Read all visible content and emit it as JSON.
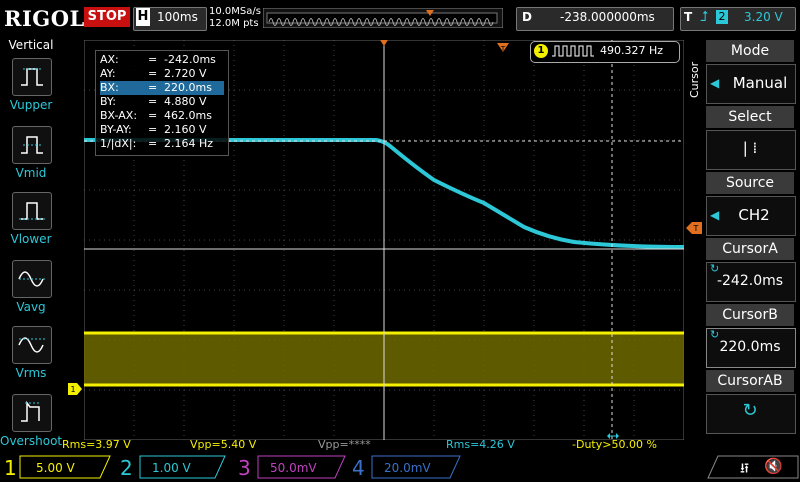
{
  "brand": "RIGOL",
  "run_state": "STOP",
  "timebase": {
    "letter": "H",
    "value": "100ms",
    "sample_rate": "10.0MSa/s",
    "mem_depth": "12.0M pts"
  },
  "delay": {
    "letter": "D",
    "value": "-238.000000ms"
  },
  "trigger": {
    "letter": "T",
    "source": "2",
    "level": "3.20 V",
    "edge_icon": "rising-edge-icon"
  },
  "left_panel": {
    "title": "Vertical",
    "items": [
      {
        "label": "Vupper",
        "icon": "vupper-icon"
      },
      {
        "label": "Vmid",
        "icon": "vmid-icon"
      },
      {
        "label": "Vlower",
        "icon": "vlower-icon"
      },
      {
        "label": "Vavg",
        "icon": "vavg-icon"
      },
      {
        "label": "Vrms",
        "icon": "vrms-icon"
      },
      {
        "label": "Overshoot",
        "icon": "overshoot-icon"
      }
    ]
  },
  "cursor_meas": [
    {
      "key": "AX:",
      "value": "-242.0ms"
    },
    {
      "key": "AY:",
      "value": "2.720 V"
    },
    {
      "key": "BX:",
      "value": "220.0ms"
    },
    {
      "key": "BY:",
      "value": "4.880 V"
    },
    {
      "key": "BX-AX:",
      "value": "462.0ms"
    },
    {
      "key": "BY-AY:",
      "value": "2.160 V"
    },
    {
      "key": "1/|dX|:",
      "value": "2.164 Hz"
    }
  ],
  "freq_counter": {
    "channel": "1",
    "value": "490.327 Hz"
  },
  "right_panel": {
    "side_label": "Cursor",
    "mode": {
      "title": "Mode",
      "value": "Manual"
    },
    "select": {
      "title": "Select",
      "value": "|  ⁞"
    },
    "source": {
      "title": "Source",
      "value": "CH2"
    },
    "cursor_a": {
      "title": "CursorA",
      "value": "-242.0ms"
    },
    "cursor_b": {
      "title": "CursorB",
      "value": "220.0ms"
    },
    "cursor_ab": {
      "title": "CursorAB"
    }
  },
  "measurements": [
    {
      "label": "Rms=3.97 V",
      "color": "#f5f000"
    },
    {
      "label": "Vpp=5.40 V",
      "color": "#f5f000"
    },
    {
      "label": "Vpp=****",
      "color": "#9a9a9a"
    },
    {
      "label": "Rms=4.26 V",
      "color": "#2cc8d8"
    },
    {
      "label": "-Duty>50.00 %",
      "color": "#f5f000"
    }
  ],
  "channels": [
    {
      "num": "1",
      "scale": "5.00 V",
      "color": "#f5f000"
    },
    {
      "num": "2",
      "scale": "1.00 V",
      "color": "#2cc8d8"
    },
    {
      "num": "3",
      "scale": "50.0mV",
      "color": "#c040c0"
    },
    {
      "num": "4",
      "scale": "20.0mV",
      "color": "#3a70c8"
    }
  ],
  "colors": {
    "ch1": "#f5f000",
    "ch2": "#2cc8d8",
    "accent": "#e07020"
  }
}
